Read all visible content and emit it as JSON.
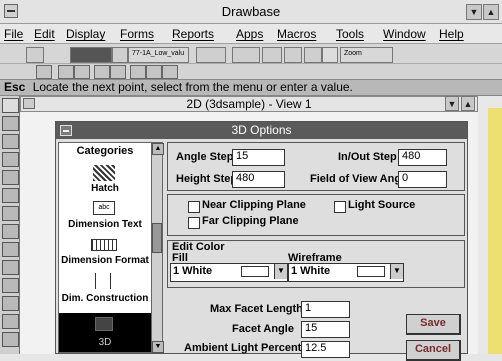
{
  "app": {
    "title": "Drawbase"
  },
  "menu": [
    "File",
    "Edit",
    "Display",
    "Forms",
    "Reports",
    "Apps",
    "Macros",
    "Tools",
    "Window",
    "Help"
  ],
  "toolbar": {
    "layer_field": "77-1A_Low_valu",
    "zoom_label": "Zoom"
  },
  "prompt": {
    "esc": "Esc",
    "text": "Locate the next point, select from the menu or enter a value."
  },
  "view": {
    "title": "2D (3dsample) - View 1"
  },
  "dialog": {
    "title": "3D Options",
    "categories_header": "Categories",
    "categories": [
      "Hatch",
      "Dimension Text",
      "Dimension Format",
      "Dim. Construction",
      "3D"
    ],
    "dim_text_icon": "abc",
    "angle_step_label": "Angle Step",
    "angle_step": "15",
    "inout_step_label": "In/Out Step",
    "inout_step": "480",
    "height_step_label": "Height Step",
    "height_step": "480",
    "fov_label": "Field of View Angle",
    "fov": "0",
    "near_clip_label": "Near Clipping Plane",
    "light_source_label": "Light Source",
    "far_clip_label": "Far Clipping Plane",
    "edit_color_label": "Edit Color",
    "fill_label": "Fill",
    "fill_value": "1 White",
    "wireframe_label": "Wireframe",
    "wireframe_value": "1 White",
    "max_facet_label": "Max Facet Length",
    "max_facet": "1",
    "facet_angle_label": "Facet Angle",
    "facet_angle": "15",
    "ambient_label": "Ambient Light Percent",
    "ambient": "12.5",
    "save_label": "Save",
    "cancel_label": "Cancel"
  }
}
